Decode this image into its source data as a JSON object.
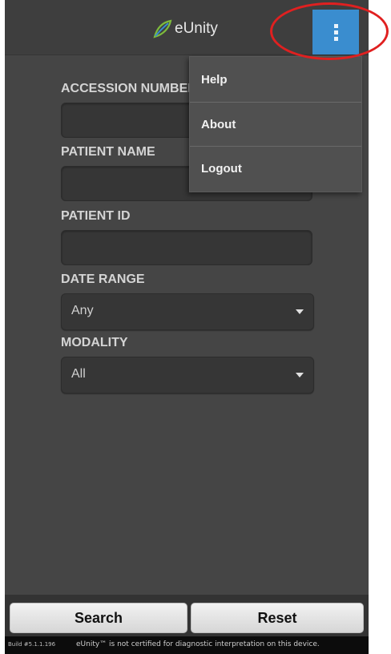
{
  "header": {
    "app_name": "eUnity",
    "menu_icon": "overflow-menu-icon",
    "brand_color": "#3a8dcf"
  },
  "form": {
    "accession_number": {
      "label": "ACCESSION NUMBER",
      "value": ""
    },
    "patient_name": {
      "label": "PATIENT NAME",
      "value": ""
    },
    "patient_id": {
      "label": "PATIENT ID",
      "value": ""
    },
    "date_range": {
      "label": "DATE RANGE",
      "selected": "Any"
    },
    "modality": {
      "label": "MODALITY",
      "selected": "All"
    }
  },
  "menu": {
    "items": [
      {
        "label": "Help"
      },
      {
        "label": "About"
      },
      {
        "label": "Logout"
      }
    ]
  },
  "actions": {
    "search_label": "Search",
    "reset_label": "Reset"
  },
  "footer": {
    "build": "Build #5.1.1.196",
    "disclaimer": "eUnity™ is not certified for diagnostic interpretation on this device."
  },
  "annotation": {
    "highlight_color": "#e02020"
  }
}
